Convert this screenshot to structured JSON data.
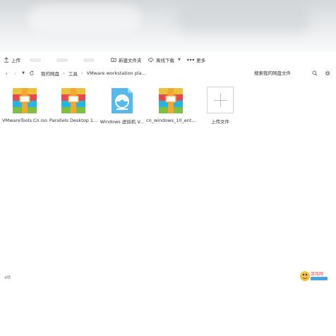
{
  "toolbar": {
    "upload": "上传",
    "new_folder": "新建文件夹",
    "offline_download": "离线下载",
    "more": "更多"
  },
  "breadcrumb": {
    "root": "我的网盘",
    "level1": "工具",
    "current": "VMware workstation pla..."
  },
  "search": {
    "placeholder": "搜索我的网盘文件"
  },
  "files": [
    {
      "name": "VMwareTools.Cn.iso",
      "icon": "archive-icon"
    },
    {
      "name": "Parallels Desktop 1...",
      "icon": "archive-icon"
    },
    {
      "name": "Windows 虚拟机 V...",
      "icon": "disc-image-icon"
    },
    {
      "name": "cn_windows_10_ent...",
      "icon": "archive-icon"
    },
    {
      "name": "上传文件",
      "icon": "plus-icon"
    }
  ],
  "status": {
    "count": "4项"
  },
  "watermark": {
    "text": "游戏网"
  },
  "colors": {
    "archive_stripes": [
      "#e9c13a",
      "#e6484f",
      "#25b4e4",
      "#7bc043"
    ],
    "archive_band": "#f3a633",
    "disc_blue": "#55b9ec"
  }
}
